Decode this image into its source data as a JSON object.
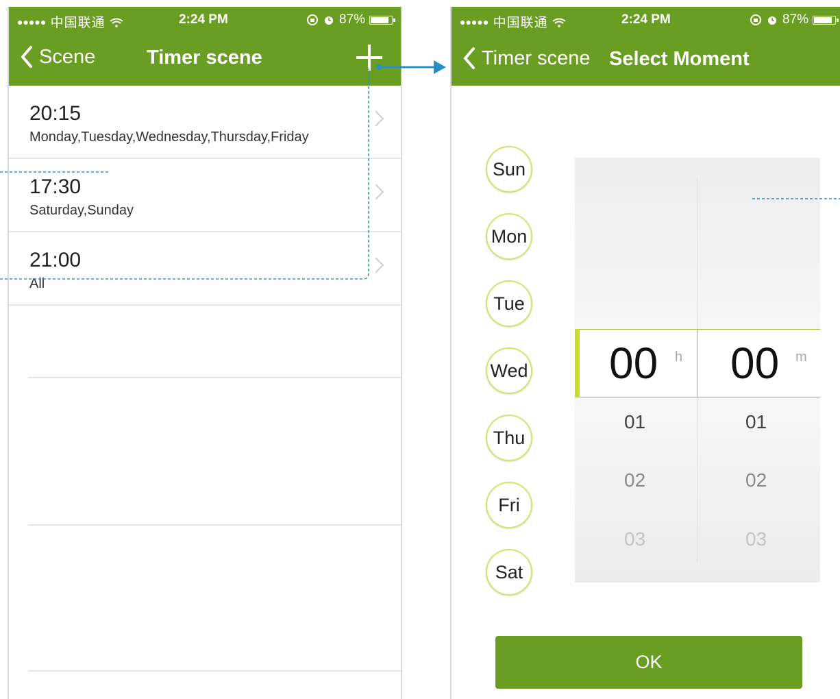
{
  "status": {
    "carrier": "中国联通",
    "time": "2:24 PM",
    "battery": "87%"
  },
  "left": {
    "back_label": "Scene",
    "title": "Timer scene",
    "timers": [
      {
        "time": "20:15",
        "days": "Monday,Tuesday,Wednesday,Thursday,Friday"
      },
      {
        "time": "17:30",
        "days": "Saturday,Sunday"
      },
      {
        "time": "21:00",
        "days": "All"
      }
    ]
  },
  "right": {
    "back_label": "Timer scene",
    "title": "Select Moment",
    "days": [
      "Sun",
      "Mon",
      "Tue",
      "Wed",
      "Thu",
      "Fri",
      "Sat"
    ],
    "hour": {
      "selected": "00",
      "unit": "h",
      "options": [
        "01",
        "02",
        "03"
      ]
    },
    "minute": {
      "selected": "00",
      "unit": "m",
      "options": [
        "01",
        "02",
        "03"
      ]
    },
    "ok_label": "OK"
  },
  "colors": {
    "brand": "#6a9e23",
    "accent": "#c8db2b",
    "annotation": "#2a8fc4"
  }
}
